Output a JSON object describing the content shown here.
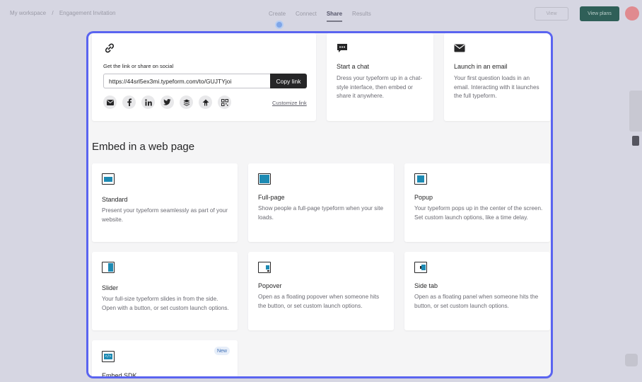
{
  "background": {
    "breadcrumb": [
      "My workspace",
      "/",
      "Engagement Invitation"
    ],
    "tabs": [
      "Create",
      "Connect",
      "Share",
      "Results"
    ],
    "active_tab": "Share",
    "ghost_button": "View",
    "primary_button": "View plans",
    "colors": {
      "accent_border": "#5a64f0",
      "primary": "#2f5f58"
    }
  },
  "share": {
    "label": "Get the link or share on social",
    "url": "https://44srl5ex3mi.typeform.com/to/GUJTYjoi",
    "copy_label": "Copy link",
    "social_icons": [
      "email-icon",
      "facebook-icon",
      "linkedin-icon",
      "twitter-icon",
      "buffer-icon",
      "reddit-icon",
      "qr-code-icon"
    ],
    "customize_label": "Customize link"
  },
  "chat": {
    "title": "Start a chat",
    "desc": "Dress your typeform up in a chat-style interface, then embed or share it anywhere."
  },
  "email": {
    "title": "Launch in an email",
    "desc": "Your first question loads in an email. Interacting with it launches the full typeform."
  },
  "embed": {
    "section_title": "Embed in a web page",
    "options": [
      {
        "title": "Standard",
        "desc": "Present your typeform seamlessly as part of your website."
      },
      {
        "title": "Full-page",
        "desc": "Show people a full-page typeform when your site loads."
      },
      {
        "title": "Popup",
        "desc": "Your typeform pops up in the center of the screen. Set custom launch options, like a time delay."
      },
      {
        "title": "Slider",
        "desc": "Your full-size typeform slides in from the side. Open with a button, or set custom launch options."
      },
      {
        "title": "Popover",
        "desc": "Open as a floating popover when someone hits the button, or set custom launch options."
      },
      {
        "title": "Side tab",
        "desc": "Open as a floating panel when someone hits the button, or set custom launch options."
      },
      {
        "title": "Embed SDK",
        "badge": "New"
      }
    ]
  }
}
